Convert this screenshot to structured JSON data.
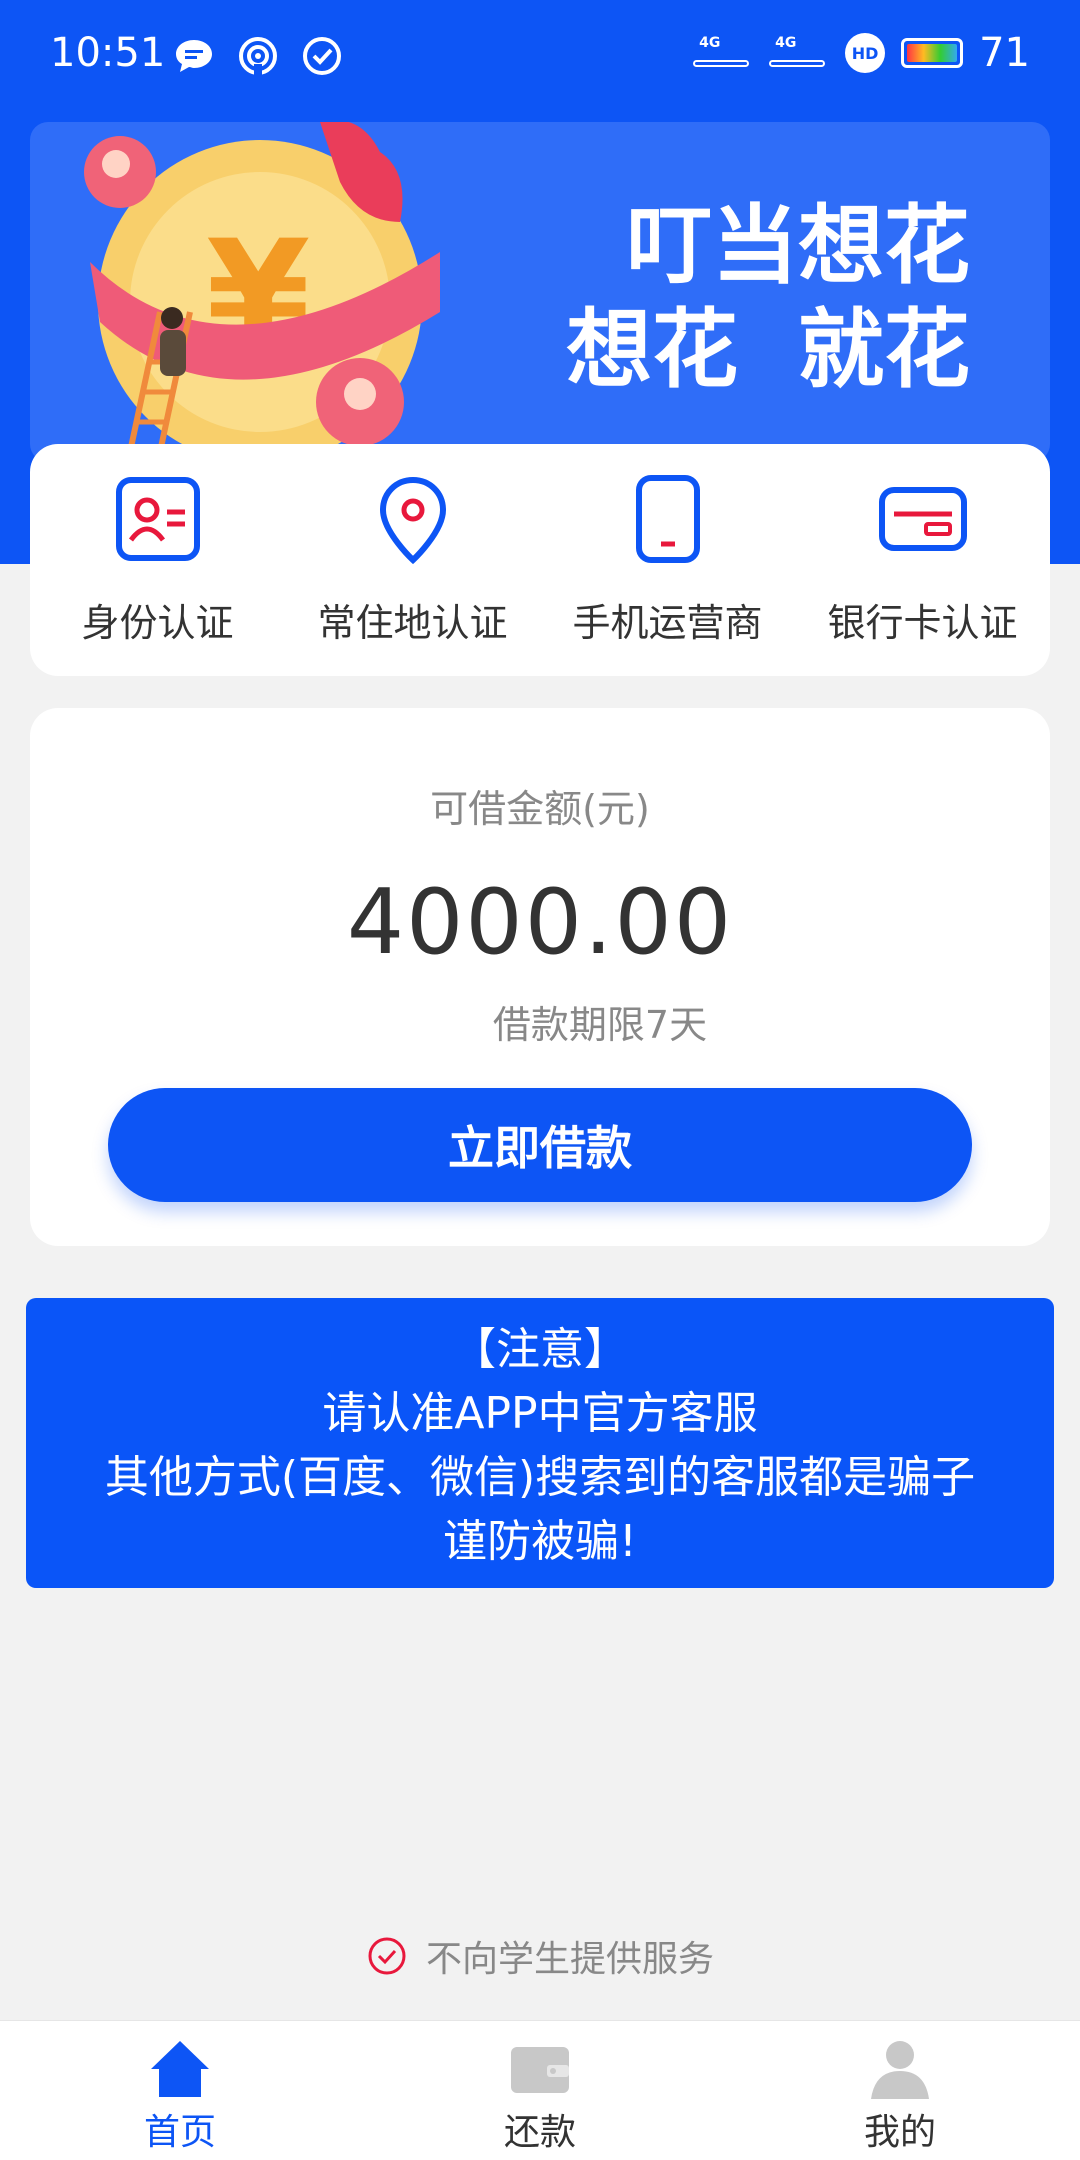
{
  "status_bar": {
    "time": "10:51",
    "battery": "71",
    "signal1": "4G",
    "signal2": "4G",
    "hd": "HD"
  },
  "banner": {
    "line1": "叮当想花",
    "line2": "想花  就花"
  },
  "certifications": [
    {
      "label": "身份认证",
      "icon": "id-card-icon"
    },
    {
      "label": "常住地认证",
      "icon": "location-pin-icon"
    },
    {
      "label": "手机运营商",
      "icon": "mobile-phone-icon"
    },
    {
      "label": "银行卡认证",
      "icon": "bank-card-icon"
    }
  ],
  "loan": {
    "label": "可借金额(元)",
    "amount": "4000.00",
    "term": "借款期限7天",
    "button": "立即借款"
  },
  "notice": {
    "title": "【注意】",
    "line1": "请认准APP中官方客服",
    "line2": "其他方式(百度、微信)搜索到的客服都是骗子",
    "line3": "谨防被骗!"
  },
  "student_notice": "不向学生提供服务",
  "tabs": [
    {
      "label": "首页",
      "icon": "home-icon",
      "active": true
    },
    {
      "label": "还款",
      "icon": "wallet-icon",
      "active": false
    },
    {
      "label": "我的",
      "icon": "user-icon",
      "active": false
    }
  ],
  "colors": {
    "primary": "#0d55f5",
    "accent_red": "#e8183c"
  }
}
